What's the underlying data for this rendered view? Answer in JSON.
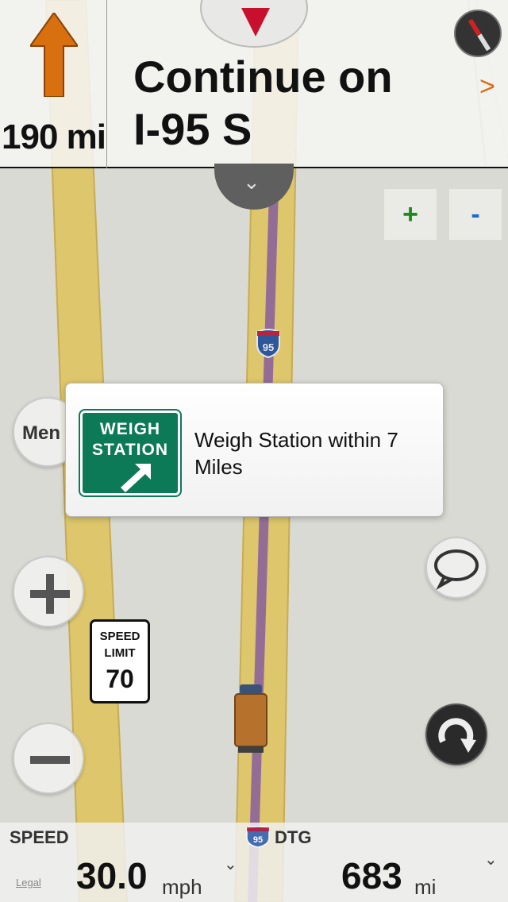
{
  "instruction": {
    "distance": "190 mi",
    "text_line1": "Continue on",
    "text_line2": "I-95 S",
    "next_chevron": ">"
  },
  "zoom": {
    "plus": "+",
    "minus": "-"
  },
  "menu": {
    "label": "Men"
  },
  "road": {
    "shield": "95"
  },
  "speed_limit": {
    "label_line1": "SPEED",
    "label_line2": "LIMIT",
    "value": "70"
  },
  "alert": {
    "sign_line1": "WEIGH",
    "sign_line2": "STATION",
    "message": "Weigh Station within 7 Miles"
  },
  "bottom": {
    "speed_label": "SPEED",
    "speed_value": "30.0",
    "speed_unit": "mph",
    "dtg_label": "DTG",
    "dtg_value": "683",
    "dtg_unit": "mi",
    "legal": "Legal"
  },
  "colors": {
    "turn_arrow": "#d9700f",
    "road_yellow": "#f3d768",
    "route_purple": "#9a6b9e",
    "sign_green": "#0d7a57",
    "zoom_plus": "#1c8a1c",
    "zoom_minus": "#1a6ec7"
  },
  "icons": {
    "turn": "straight-arrow-icon",
    "compass": "compass-icon",
    "collapse": "chevron-down-icon",
    "chat": "speech-bubble-icon",
    "recalc": "reroute-icon",
    "vehicle": "truck-icon"
  }
}
